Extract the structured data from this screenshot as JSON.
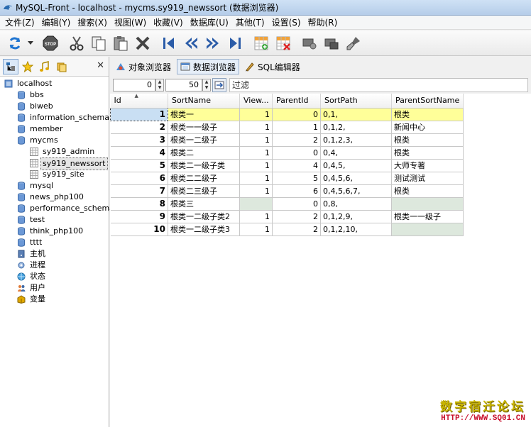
{
  "window": {
    "title": "MySQL-Front - localhost - mycms.sy919_newssort (数据浏览器)"
  },
  "menu": [
    "文件(Z)",
    "编辑(Y)",
    "搜索(X)",
    "视图(W)",
    "收藏(V)",
    "数据库(U)",
    "其他(T)",
    "设置(S)",
    "帮助(R)"
  ],
  "toolbar": [
    "refresh-icon",
    "stop-icon",
    "cut-icon",
    "copy-icon",
    "paste-icon",
    "delete-icon",
    "first-icon",
    "prev-icon",
    "next-icon",
    "last-icon",
    "insert-record-icon",
    "delete-record-icon",
    "post-icon",
    "cancel-icon",
    "clear-icon"
  ],
  "tree": {
    "root": "localhost",
    "databases": [
      "bbs",
      "biweb",
      "information_schema",
      "member",
      "mycms"
    ],
    "mycms_tables": [
      "sy919_admin",
      "sy919_newssort",
      "sy919_site"
    ],
    "databases_after": [
      "mysql",
      "news_php100",
      "performance_schema",
      "test",
      "think_php100",
      "tttt"
    ],
    "extras": [
      "主机",
      "进程",
      "状态",
      "用户",
      "变量"
    ]
  },
  "tabs": [
    "对象浏览器",
    "数据浏览器",
    "SQL编辑器"
  ],
  "filter": {
    "offset": "0",
    "limit": "50",
    "placeholder": "过滤"
  },
  "grid": {
    "columns": [
      "Id",
      "SortName",
      "View...",
      "ParentId",
      "SortPath",
      "ParentSortName"
    ],
    "rows": [
      [
        "1",
        "根类一",
        "1",
        "0",
        "0,1,",
        "根类"
      ],
      [
        "2",
        "根类一一级子",
        "1",
        "1",
        "0,1,2,",
        "新闻中心"
      ],
      [
        "3",
        "根类一二级子",
        "1",
        "2",
        "0,1,2,3,",
        "根类"
      ],
      [
        "4",
        "根类二",
        "1",
        "0",
        "0,4,",
        "根类"
      ],
      [
        "5",
        "根类二一级子类",
        "1",
        "4",
        "0,4,5,",
        "大师专著"
      ],
      [
        "6",
        "根类二二级子",
        "1",
        "5",
        "0,4,5,6,",
        "测试测试"
      ],
      [
        "7",
        "根类二三级子",
        "1",
        "6",
        "0,4,5,6,7,",
        "根类"
      ],
      [
        "8",
        "根类三",
        "",
        "0",
        "0,8,",
        ""
      ],
      [
        "9",
        "根类一二级子类2",
        "1",
        "2",
        "0,1,2,9,",
        "根类一一级子"
      ],
      [
        "10",
        "根类一二级子类3",
        "1",
        "2",
        "0,1,2,10,",
        ""
      ]
    ]
  },
  "watermark": {
    "line1": "数字宿迁论坛",
    "line2": "HTTP://WWW.SQ01.CN"
  },
  "colors": {
    "selected_row": "#ffff99",
    "null_cell": "#dde8dd",
    "title_bar": "#cfe1f5"
  }
}
